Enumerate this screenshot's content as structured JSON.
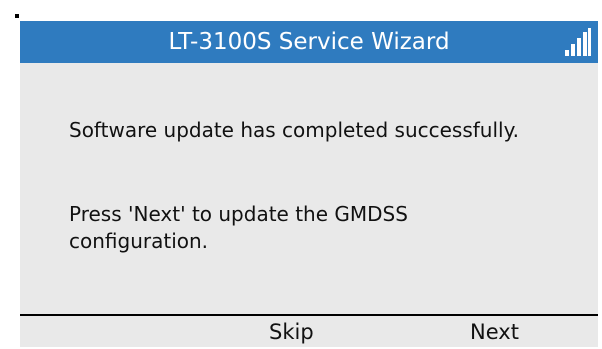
{
  "header": {
    "title": "LT-3100S Service Wizard",
    "signal_icon": "signal-strength-icon",
    "background_color": "#2f7bbf",
    "text_color": "#ffffff"
  },
  "content": {
    "message_update": "Software update has completed successfully.",
    "message_next": "Press 'Next' to update the GMDSS configuration.",
    "background_color": "#e9e9e9"
  },
  "softkeys": {
    "skip_label": "Skip",
    "next_label": "Next"
  }
}
